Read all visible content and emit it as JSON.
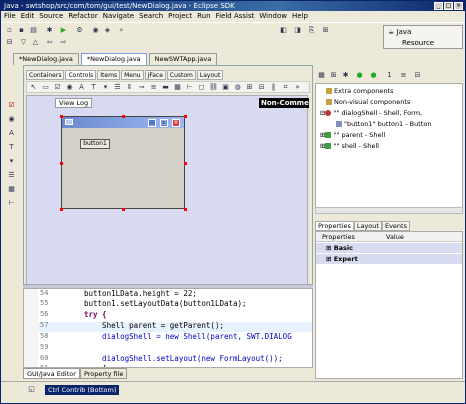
{
  "window": {
    "title": "Java - swtshop/src/com/tom/gui/test/NewDialog.java - Eclipse SDK"
  },
  "menu": [
    "File",
    "Edit",
    "Source",
    "Refactor",
    "Navigate",
    "Search",
    "Project",
    "Run",
    "Field Assist",
    "Window",
    "Help"
  ],
  "perspective": {
    "java_label": "Java",
    "resource_label": "Resource"
  },
  "editor_tabs": [
    {
      "label": "*NewDialog.java"
    },
    {
      "label": "*NewDialog.java"
    },
    {
      "label": "NewSWTApp.java"
    }
  ],
  "palette_tabs": [
    "Containers",
    "Controls",
    "Items",
    "Menu",
    "JFace",
    "Custom",
    "Layout"
  ],
  "designer": {
    "view_log": "View Log",
    "non_comm": "Non-Comme",
    "button_label": "button1"
  },
  "code": {
    "lines": [
      {
        "num": "54",
        "text": "button1LData.height = 22;"
      },
      {
        "num": "55",
        "text": "button1.setLayoutData(button1LData);"
      },
      {
        "num": "56",
        "text": "try {"
      },
      {
        "num": "57",
        "text": "    Shell parent = getParent();"
      },
      {
        "num": "58",
        "text": "    dialogShell = new Shell(parent, SWT.DIALOG"
      },
      {
        "num": "59",
        "text": ""
      },
      {
        "num": "60",
        "text": "    dialogShell.setLayout(new FormLayout());"
      },
      {
        "num": "61",
        "text": "    {"
      }
    ]
  },
  "bottom_tabs": [
    "GUI/Java Editor",
    "Property file"
  ],
  "status": {
    "label": "Ctrl Contrib (Bottom)"
  },
  "tree": {
    "items": [
      {
        "label": "Extra components"
      },
      {
        "label": "Non-visual components"
      },
      {
        "label": "\"\" dialogShell - Shell, Form,"
      },
      {
        "label": "\"button1\" button1 - Button"
      },
      {
        "label": "\"\" parent - Shell"
      },
      {
        "label": "\"\" shell - Shell"
      }
    ]
  },
  "properties": {
    "tabs": [
      "Properties",
      "Layout",
      "Events"
    ],
    "headers": [
      "Properties",
      "Value"
    ],
    "groups": [
      "Basic",
      "Expert"
    ]
  }
}
